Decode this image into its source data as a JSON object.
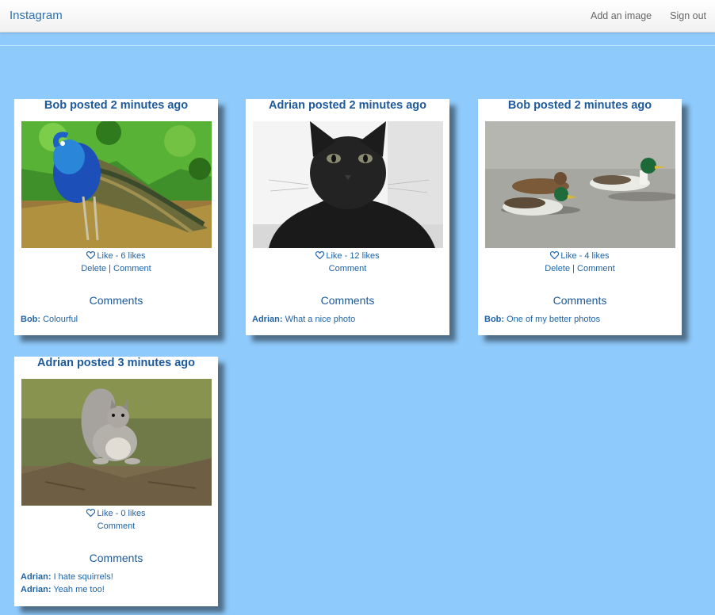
{
  "navbar": {
    "brand": "Instagram",
    "add_image": "Add an image",
    "sign_out": "Sign out"
  },
  "posts": [
    {
      "title": "Bob posted 2 minutes ago",
      "image": "peacock",
      "like_label": "Like - 6 likes",
      "delete_label": "Delete",
      "comment_label": "Comment",
      "comments_heading": "Comments",
      "comments": [
        {
          "author": "Bob:",
          "text": "Colourful"
        }
      ]
    },
    {
      "title": "Adrian posted 2 minutes ago",
      "image": "black-cat",
      "like_label": "Like - 12 likes",
      "comment_label": "Comment",
      "comments_heading": "Comments",
      "comments": [
        {
          "author": "Adrian:",
          "text": "What a nice photo"
        }
      ]
    },
    {
      "title": "Bob posted 2 minutes ago",
      "image": "ducks",
      "like_label": "Like - 4 likes",
      "delete_label": "Delete",
      "comment_label": "Comment",
      "comments_heading": "Comments",
      "comments": [
        {
          "author": "Bob:",
          "text": "One of my better photos"
        }
      ]
    },
    {
      "title": "Adrian posted 3 minutes ago",
      "image": "squirrel",
      "like_label": "Like - 0 likes",
      "comment_label": "Comment",
      "comments_heading": "Comments",
      "comments": [
        {
          "author": "Adrian:",
          "text": "I hate squirrels!"
        },
        {
          "author": "Adrian:",
          "text": "Yeah me too!"
        }
      ]
    }
  ],
  "colors": {
    "background": "#8ecafb",
    "link": "#1f63a6",
    "heading": "#1d5a9c"
  },
  "icons": {
    "like": "heart-outline-icon"
  }
}
